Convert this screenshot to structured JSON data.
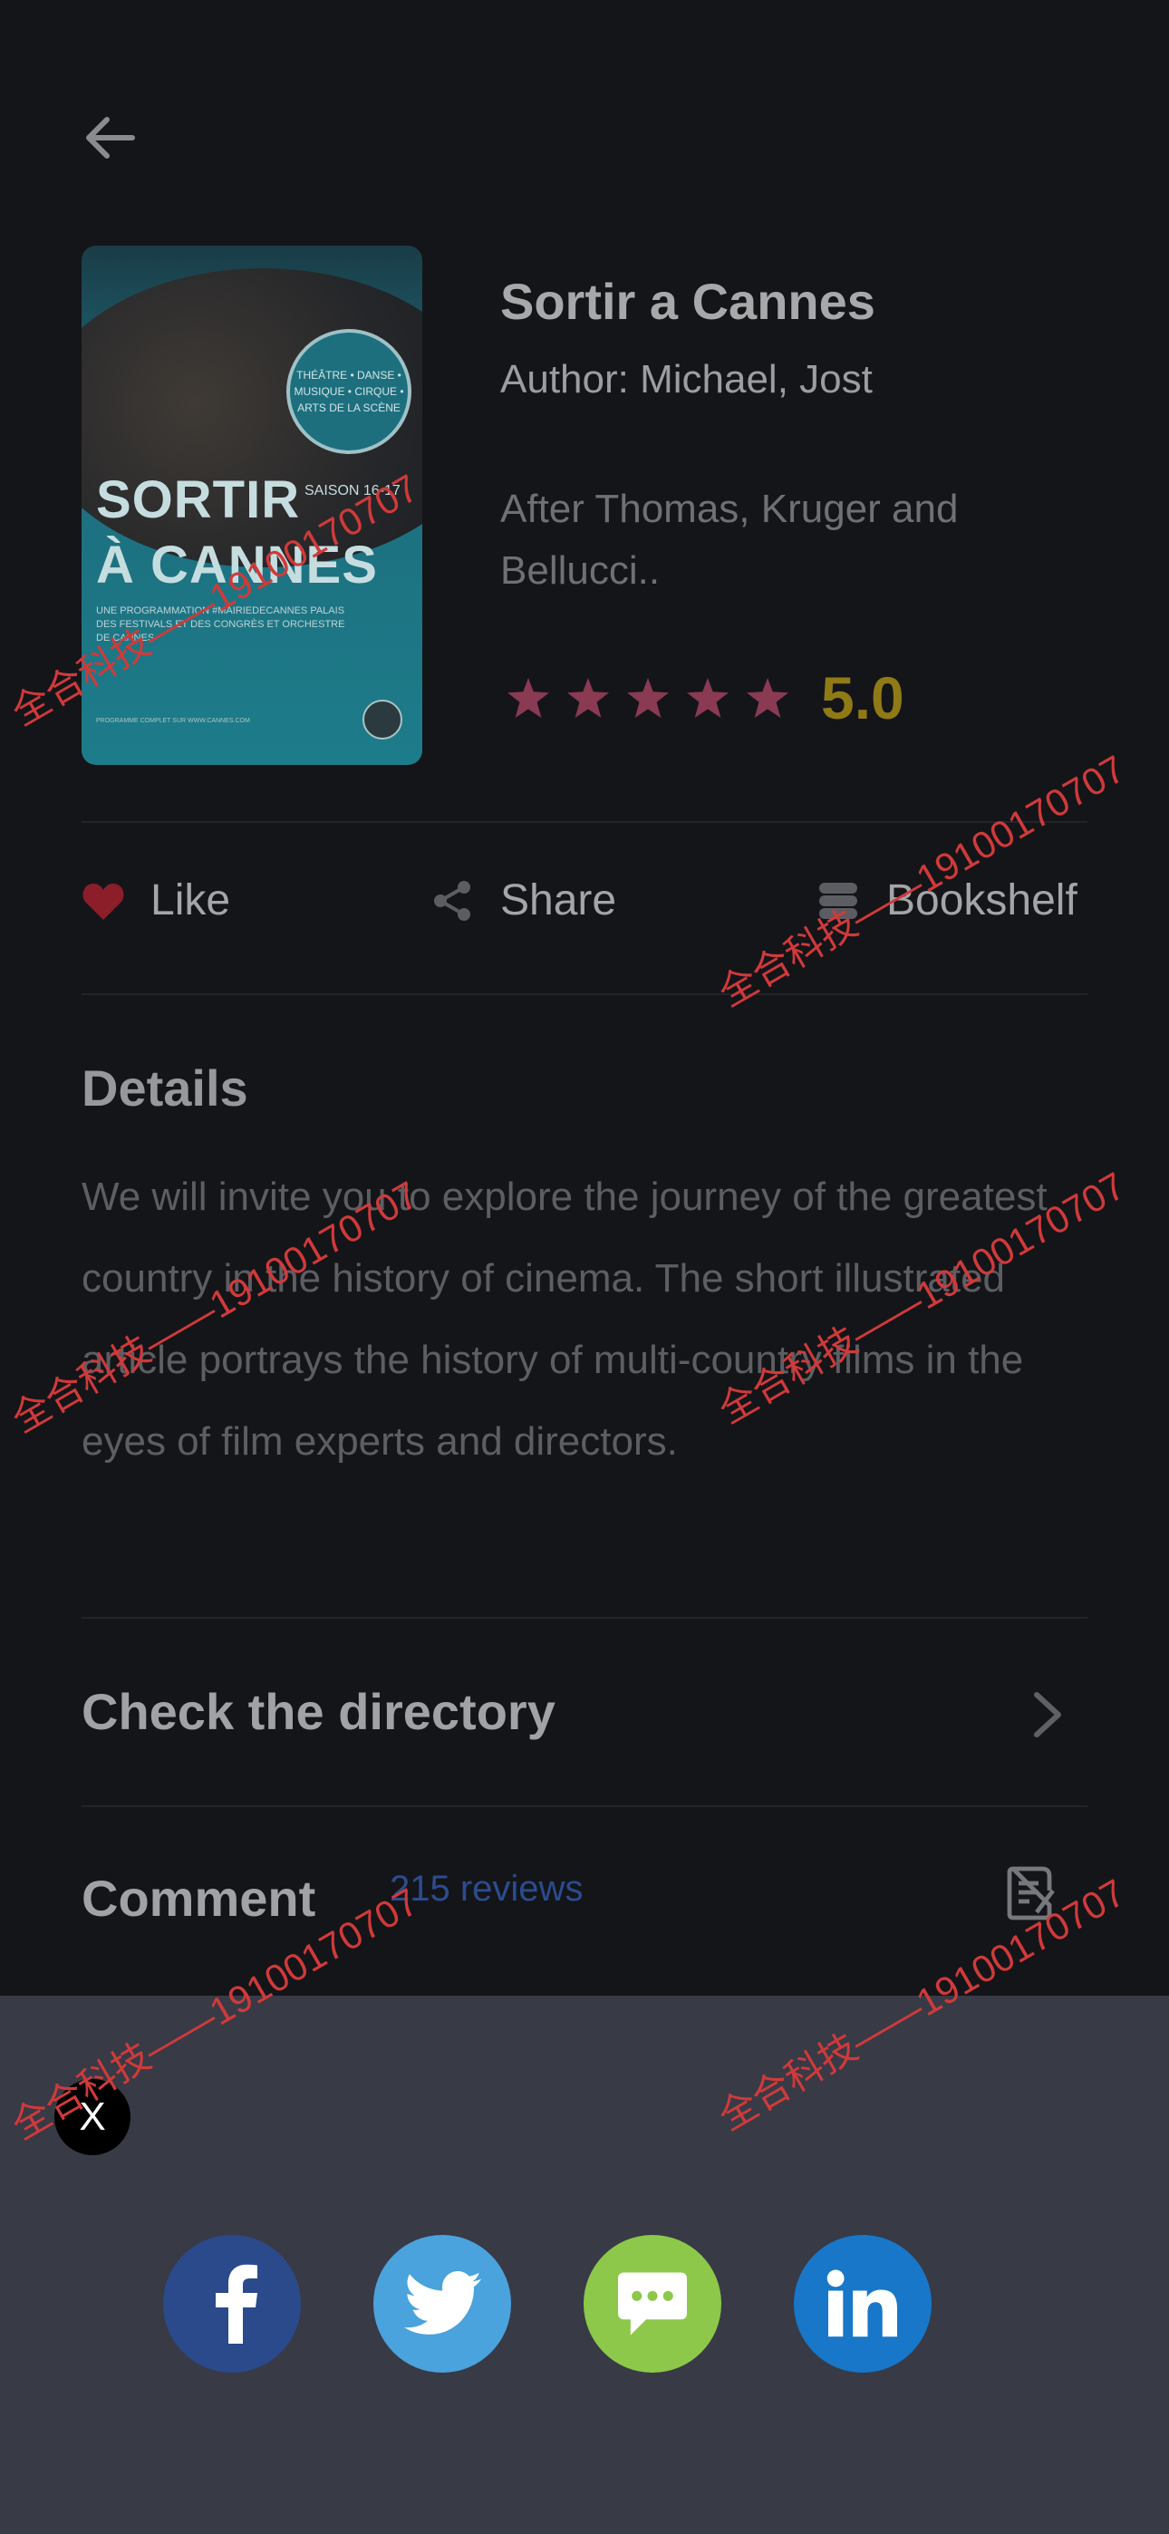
{
  "book": {
    "title": "Sortir a Cannes",
    "author": "Author: Michael, Jost",
    "description": "After Thomas, Kruger and Bellucci..",
    "rating_value": "5.0",
    "stars": 5,
    "cover": {
      "title_line1": "SORTIR",
      "title_line2": "À CANNES",
      "saison": "SAISON 16-17",
      "badge": "THÉÂTRE • DANSE • MUSIQUE • CIRQUE • ARTS DE LA SCÈNE",
      "subtitle": "UNE PROGRAMMATION #MAIRIEDECANNES PALAIS DES FESTIVALS ET DES CONGRÈS ET ORCHESTRE DE CANNES",
      "footer": "PROGRAMME COMPLET SUR WWW.CANNES.COM"
    }
  },
  "actions": {
    "like": "Like",
    "share": "Share",
    "bookshelf": "Bookshelf"
  },
  "details": {
    "heading": "Details",
    "text": "We will invite you to explore the journey of the greatest country in the history of cinema. The short illustrated article portrays the history of multi-country films in the eyes of film experts and directors."
  },
  "directory": {
    "heading": "Check the directory"
  },
  "comment": {
    "heading": "Comment",
    "reviews": "215 reviews"
  },
  "share_sheet": {
    "close_label": "X",
    "targets": [
      "facebook",
      "twitter",
      "messages",
      "linkedin"
    ]
  },
  "watermark": "全合科技——19100170707",
  "colors": {
    "background": "#141519",
    "rating": "#8f7a16",
    "star": "#8a3a52",
    "like_heart": "#8b1e28",
    "reviews_link": "#2b4c8e",
    "sheet": "#383a46",
    "facebook": "#2b4a8c",
    "twitter": "#4aa3dd",
    "messages": "#8dc84a",
    "linkedin": "#1877c8"
  }
}
